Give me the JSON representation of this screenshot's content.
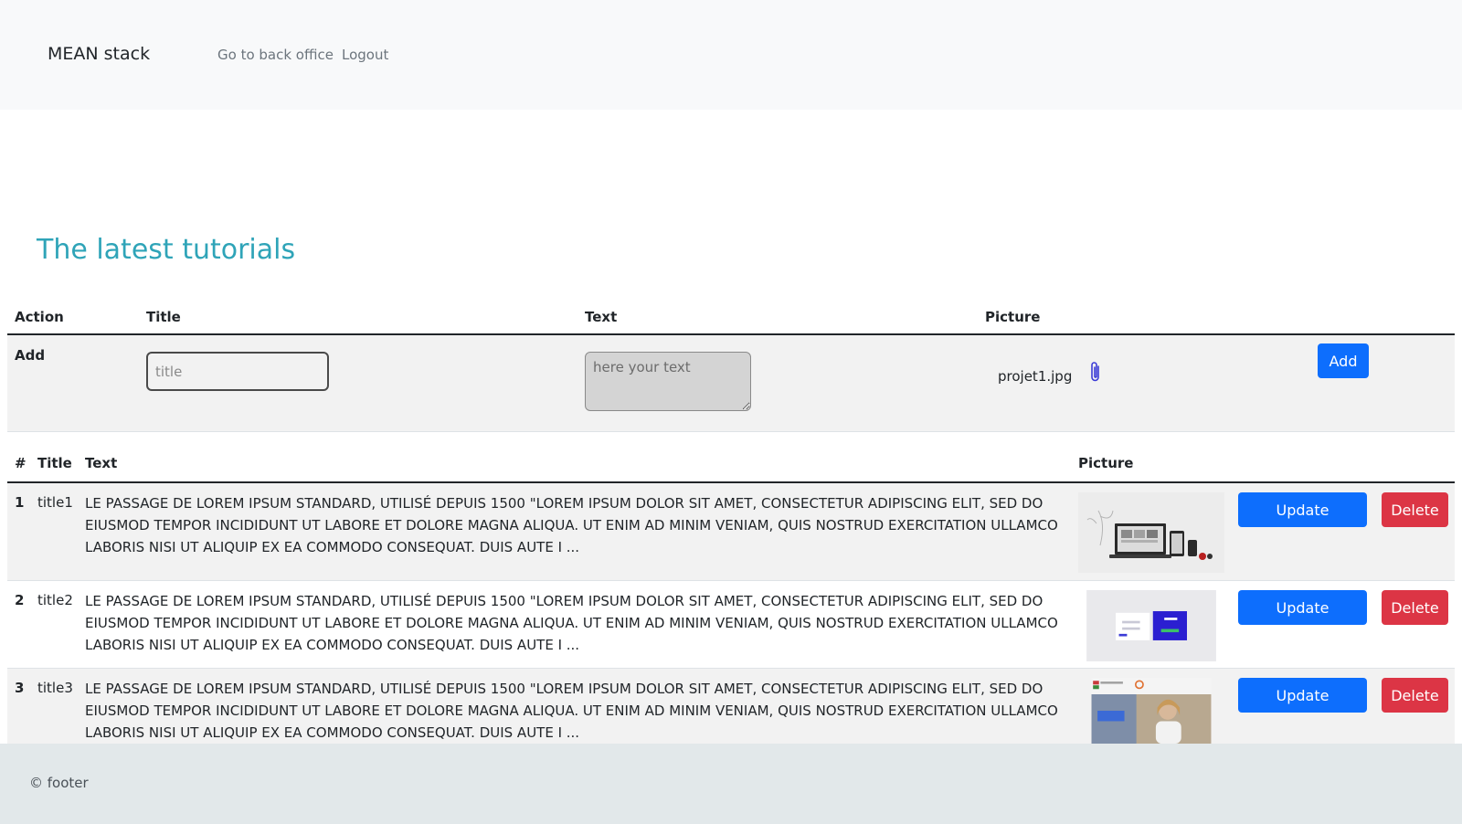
{
  "nav": {
    "brand": "MEAN stack",
    "links": [
      "Go to back office",
      "Logout"
    ]
  },
  "heading": "The latest tutorials",
  "add_form": {
    "headers": [
      "Action",
      "Title",
      "Text",
      "Picture"
    ],
    "action_label": "Add",
    "title_placeholder": "title",
    "text_placeholder": "here your text",
    "filename": "projet1.jpg",
    "attach_icon": "paperclip-icon",
    "add_button": "Add"
  },
  "list": {
    "headers": [
      "#",
      "Title",
      "Text",
      "Picture"
    ],
    "rows": [
      {
        "num": "1",
        "title": "title1",
        "text": "LE PASSAGE DE LOREM IPSUM STANDARD, UTILISÉ DEPUIS 1500 \"LOREM IPSUM DOLOR SIT AMET, CONSECTETUR ADIPISCING ELIT, SED DO EIUSMOD TEMPOR INCIDIDUNT UT LABORE ET DOLORE MAGNA ALIQUA. UT ENIM AD MINIM VENIAM, QUIS NOSTRUD EXERCITATION ULLAMCO LABORIS NISI UT ALIQUIP EX EA COMMODO CONSEQUAT. DUIS AUTE I ...",
        "update": "Update",
        "delete": "Delete"
      },
      {
        "num": "2",
        "title": "title2",
        "text": "LE PASSAGE DE LOREM IPSUM STANDARD, UTILISÉ DEPUIS 1500 \"LOREM IPSUM DOLOR SIT AMET, CONSECTETUR ADIPISCING ELIT, SED DO EIUSMOD TEMPOR INCIDIDUNT UT LABORE ET DOLORE MAGNA ALIQUA. UT ENIM AD MINIM VENIAM, QUIS NOSTRUD EXERCITATION ULLAMCO LABORIS NISI UT ALIQUIP EX EA COMMODO CONSEQUAT. DUIS AUTE I ...",
        "update": "Update",
        "delete": "Delete"
      },
      {
        "num": "3",
        "title": "title3",
        "text": "LE PASSAGE DE LOREM IPSUM STANDARD, UTILISÉ DEPUIS 1500 \"LOREM IPSUM DOLOR SIT AMET, CONSECTETUR ADIPISCING ELIT, SED DO EIUSMOD TEMPOR INCIDIDUNT UT LABORE ET DOLORE MAGNA ALIQUA. UT ENIM AD MINIM VENIAM, QUIS NOSTRUD EXERCITATION ULLAMCO LABORIS NISI UT ALIQUIP EX EA COMMODO CONSEQUAT. DUIS AUTE I ...",
        "update": "Update",
        "delete": "Delete"
      }
    ]
  },
  "footer": "© footer",
  "colors": {
    "heading": "#2fa4b8",
    "primary": "#0d6efd",
    "danger": "#dc3545",
    "navbar_bg": "#f8f9fa",
    "footer_bg": "#e2e8ea"
  }
}
